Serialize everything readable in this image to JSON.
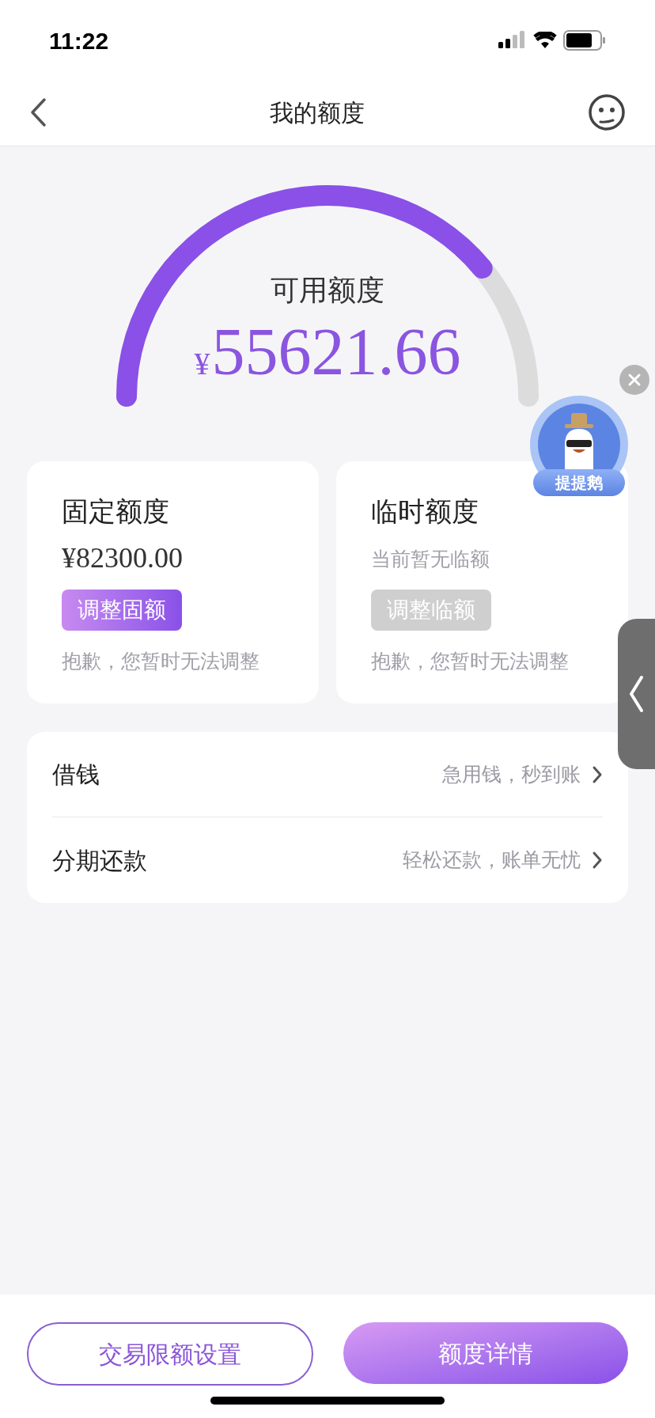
{
  "status_bar": {
    "time": "11:22"
  },
  "nav": {
    "title": "我的额度"
  },
  "gauge": {
    "label": "可用额度",
    "currency": "¥",
    "amount": "55621.66"
  },
  "floating_badge": {
    "label": "提提鹅"
  },
  "cards": [
    {
      "title": "固定额度",
      "value": "¥82300.00",
      "kind": "amount",
      "button": "调整固额",
      "button_disabled": false,
      "note": "抱歉，您暂时无法调整"
    },
    {
      "title": "临时额度",
      "value": "当前暂无临额",
      "kind": "hint",
      "button": "调整临额",
      "button_disabled": true,
      "note": "抱歉，您暂时无法调整"
    }
  ],
  "menu": [
    {
      "label": "借钱",
      "hint": "急用钱，秒到账"
    },
    {
      "label": "分期还款",
      "hint": "轻松还款，账单无忧"
    }
  ],
  "bottom_buttons": [
    {
      "label": "交易限额设置",
      "kind": "outline"
    },
    {
      "label": "额度详情",
      "kind": "filled"
    }
  ]
}
